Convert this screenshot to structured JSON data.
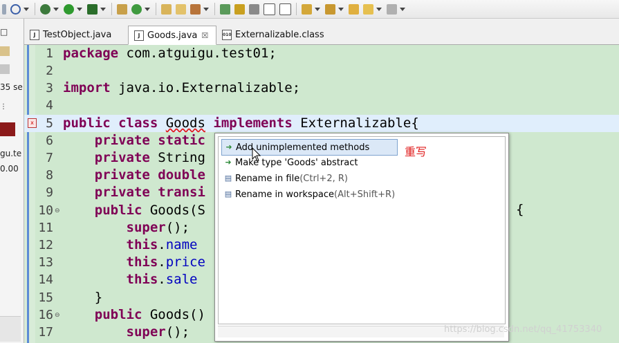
{
  "toolbar": {
    "icons": [
      "toggle-icon",
      "debug-icon",
      "run-icon",
      "external-tools-icon",
      "new-java-project-icon",
      "new-class-icon",
      "open-type-icon",
      "open-task-icon",
      "search-icon",
      "pin-icon",
      "highlight-icon",
      "toggle-block-icon",
      "show-whitespace-icon",
      "next-annotation-icon",
      "previous-annotation-icon",
      "back-icon",
      "forward-icon"
    ]
  },
  "left_panel": {
    "texts": [
      "35 se",
      "gu.te",
      "0.00"
    ]
  },
  "tabs": [
    {
      "label": "TestObject.java",
      "icon": "java-file-icon"
    },
    {
      "label": "Goods.java",
      "icon": "java-file-icon",
      "close": "☒"
    },
    {
      "label": "Externalizable.class",
      "icon": "class-file-icon"
    }
  ],
  "editor": {
    "line_numbers": [
      "1",
      "2",
      "3",
      "4",
      "5",
      "6",
      "7",
      "8",
      "9",
      "10",
      "11",
      "12",
      "13",
      "14",
      "15",
      "16",
      "17"
    ],
    "lines": [
      {
        "kw": "package",
        "rest": " com.atguigu.test01;"
      },
      {
        "kw": "",
        "rest": ""
      },
      {
        "kw": "import",
        "rest": " java.io.Externalizable;"
      },
      {
        "kw": "",
        "rest": ""
      },
      {
        "kw": "public class",
        "rest": " ",
        "err": "Goods",
        "kw2": " implements",
        "rest2": " Externalizable{"
      },
      {
        "indent": "    ",
        "kw": "private static",
        "rest": ""
      },
      {
        "indent": "    ",
        "kw": "private",
        "rest": " String"
      },
      {
        "indent": "    ",
        "kw": "private double",
        "rest": ""
      },
      {
        "indent": "    ",
        "kw": "private transi",
        "rest": ""
      },
      {
        "indent": "    ",
        "kw": "public",
        "rest": " Goods(S"
      },
      {
        "indent": "        ",
        "kw": "super",
        "rest": "();"
      },
      {
        "indent": "        ",
        "kw": "this",
        "rest": ".",
        "fld": "name"
      },
      {
        "indent": "        ",
        "kw": "this",
        "rest": ".",
        "fld": "price"
      },
      {
        "indent": "        ",
        "kw": "this",
        "rest": ".",
        "fld": "sale"
      },
      {
        "indent": "    ",
        "kw": "",
        "rest": "}"
      },
      {
        "indent": "    ",
        "kw": "public",
        "rest": " Goods()"
      },
      {
        "indent": "        ",
        "kw": "super",
        "rest": "();"
      }
    ],
    "brace": "{"
  },
  "quickfix": {
    "items": [
      {
        "label": "Add unimplemented methods",
        "hint": "",
        "icon": "quickfix-green-icon",
        "selected": true
      },
      {
        "label": "Make type 'Goods' abstract",
        "hint": "",
        "icon": "quickfix-green-icon"
      },
      {
        "label": "Rename in file",
        "hint": " (Ctrl+2, R)",
        "icon": "rename-icon"
      },
      {
        "label": "Rename in workspace",
        "hint": " (Alt+Shift+R)",
        "icon": "rename-icon"
      }
    ]
  },
  "annotation": "重写",
  "watermark": "https://blog.csdn.net/qq_41753340"
}
